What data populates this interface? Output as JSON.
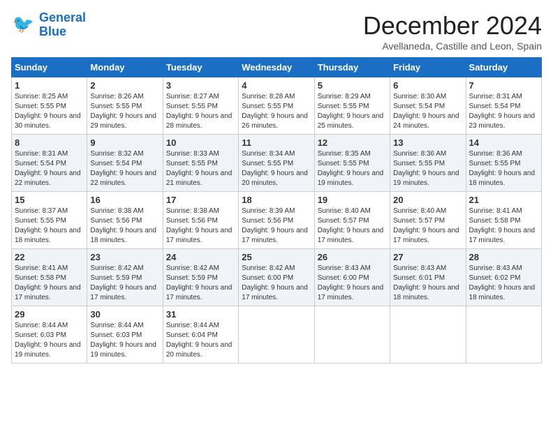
{
  "logo": {
    "line1": "General",
    "line2": "Blue"
  },
  "title": "December 2024",
  "subtitle": "Avellaneda, Castille and Leon, Spain",
  "days_of_week": [
    "Sunday",
    "Monday",
    "Tuesday",
    "Wednesday",
    "Thursday",
    "Friday",
    "Saturday"
  ],
  "weeks": [
    [
      {
        "day": "1",
        "sunrise": "Sunrise: 8:25 AM",
        "sunset": "Sunset: 5:55 PM",
        "daylight": "Daylight: 9 hours and 30 minutes."
      },
      {
        "day": "2",
        "sunrise": "Sunrise: 8:26 AM",
        "sunset": "Sunset: 5:55 PM",
        "daylight": "Daylight: 9 hours and 29 minutes."
      },
      {
        "day": "3",
        "sunrise": "Sunrise: 8:27 AM",
        "sunset": "Sunset: 5:55 PM",
        "daylight": "Daylight: 9 hours and 28 minutes."
      },
      {
        "day": "4",
        "sunrise": "Sunrise: 8:28 AM",
        "sunset": "Sunset: 5:55 PM",
        "daylight": "Daylight: 9 hours and 26 minutes."
      },
      {
        "day": "5",
        "sunrise": "Sunrise: 8:29 AM",
        "sunset": "Sunset: 5:55 PM",
        "daylight": "Daylight: 9 hours and 25 minutes."
      },
      {
        "day": "6",
        "sunrise": "Sunrise: 8:30 AM",
        "sunset": "Sunset: 5:54 PM",
        "daylight": "Daylight: 9 hours and 24 minutes."
      },
      {
        "day": "7",
        "sunrise": "Sunrise: 8:31 AM",
        "sunset": "Sunset: 5:54 PM",
        "daylight": "Daylight: 9 hours and 23 minutes."
      }
    ],
    [
      {
        "day": "8",
        "sunrise": "Sunrise: 8:31 AM",
        "sunset": "Sunset: 5:54 PM",
        "daylight": "Daylight: 9 hours and 22 minutes."
      },
      {
        "day": "9",
        "sunrise": "Sunrise: 8:32 AM",
        "sunset": "Sunset: 5:54 PM",
        "daylight": "Daylight: 9 hours and 22 minutes."
      },
      {
        "day": "10",
        "sunrise": "Sunrise: 8:33 AM",
        "sunset": "Sunset: 5:55 PM",
        "daylight": "Daylight: 9 hours and 21 minutes."
      },
      {
        "day": "11",
        "sunrise": "Sunrise: 8:34 AM",
        "sunset": "Sunset: 5:55 PM",
        "daylight": "Daylight: 9 hours and 20 minutes."
      },
      {
        "day": "12",
        "sunrise": "Sunrise: 8:35 AM",
        "sunset": "Sunset: 5:55 PM",
        "daylight": "Daylight: 9 hours and 19 minutes."
      },
      {
        "day": "13",
        "sunrise": "Sunrise: 8:36 AM",
        "sunset": "Sunset: 5:55 PM",
        "daylight": "Daylight: 9 hours and 19 minutes."
      },
      {
        "day": "14",
        "sunrise": "Sunrise: 8:36 AM",
        "sunset": "Sunset: 5:55 PM",
        "daylight": "Daylight: 9 hours and 18 minutes."
      }
    ],
    [
      {
        "day": "15",
        "sunrise": "Sunrise: 8:37 AM",
        "sunset": "Sunset: 5:55 PM",
        "daylight": "Daylight: 9 hours and 18 minutes."
      },
      {
        "day": "16",
        "sunrise": "Sunrise: 8:38 AM",
        "sunset": "Sunset: 5:56 PM",
        "daylight": "Daylight: 9 hours and 18 minutes."
      },
      {
        "day": "17",
        "sunrise": "Sunrise: 8:38 AM",
        "sunset": "Sunset: 5:56 PM",
        "daylight": "Daylight: 9 hours and 17 minutes."
      },
      {
        "day": "18",
        "sunrise": "Sunrise: 8:39 AM",
        "sunset": "Sunset: 5:56 PM",
        "daylight": "Daylight: 9 hours and 17 minutes."
      },
      {
        "day": "19",
        "sunrise": "Sunrise: 8:40 AM",
        "sunset": "Sunset: 5:57 PM",
        "daylight": "Daylight: 9 hours and 17 minutes."
      },
      {
        "day": "20",
        "sunrise": "Sunrise: 8:40 AM",
        "sunset": "Sunset: 5:57 PM",
        "daylight": "Daylight: 9 hours and 17 minutes."
      },
      {
        "day": "21",
        "sunrise": "Sunrise: 8:41 AM",
        "sunset": "Sunset: 5:58 PM",
        "daylight": "Daylight: 9 hours and 17 minutes."
      }
    ],
    [
      {
        "day": "22",
        "sunrise": "Sunrise: 8:41 AM",
        "sunset": "Sunset: 5:58 PM",
        "daylight": "Daylight: 9 hours and 17 minutes."
      },
      {
        "day": "23",
        "sunrise": "Sunrise: 8:42 AM",
        "sunset": "Sunset: 5:59 PM",
        "daylight": "Daylight: 9 hours and 17 minutes."
      },
      {
        "day": "24",
        "sunrise": "Sunrise: 8:42 AM",
        "sunset": "Sunset: 5:59 PM",
        "daylight": "Daylight: 9 hours and 17 minutes."
      },
      {
        "day": "25",
        "sunrise": "Sunrise: 8:42 AM",
        "sunset": "Sunset: 6:00 PM",
        "daylight": "Daylight: 9 hours and 17 minutes."
      },
      {
        "day": "26",
        "sunrise": "Sunrise: 8:43 AM",
        "sunset": "Sunset: 6:00 PM",
        "daylight": "Daylight: 9 hours and 17 minutes."
      },
      {
        "day": "27",
        "sunrise": "Sunrise: 8:43 AM",
        "sunset": "Sunset: 6:01 PM",
        "daylight": "Daylight: 9 hours and 18 minutes."
      },
      {
        "day": "28",
        "sunrise": "Sunrise: 8:43 AM",
        "sunset": "Sunset: 6:02 PM",
        "daylight": "Daylight: 9 hours and 18 minutes."
      }
    ],
    [
      {
        "day": "29",
        "sunrise": "Sunrise: 8:44 AM",
        "sunset": "Sunset: 6:03 PM",
        "daylight": "Daylight: 9 hours and 19 minutes."
      },
      {
        "day": "30",
        "sunrise": "Sunrise: 8:44 AM",
        "sunset": "Sunset: 6:03 PM",
        "daylight": "Daylight: 9 hours and 19 minutes."
      },
      {
        "day": "31",
        "sunrise": "Sunrise: 8:44 AM",
        "sunset": "Sunset: 6:04 PM",
        "daylight": "Daylight: 9 hours and 20 minutes."
      },
      null,
      null,
      null,
      null
    ]
  ]
}
